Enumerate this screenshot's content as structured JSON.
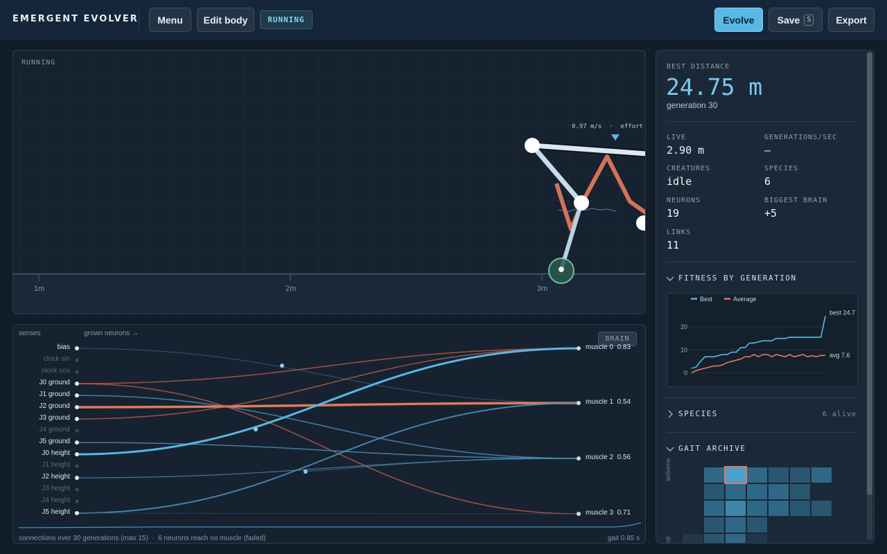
{
  "header": {
    "title": "EMERGENT EVOLVER",
    "menu_label": "Menu",
    "edit_label": "Edit body",
    "status": "RUNNING",
    "evolve_label": "Evolve",
    "save_label": "Save",
    "save_key": "S",
    "export_label": "Export"
  },
  "arena": {
    "label": "RUNNING",
    "ticks": [
      "1m",
      "2m",
      "3m"
    ],
    "readout": "0.97 m/s  ·  effort"
  },
  "brain": {
    "senses_label": "senses",
    "grown_label": "grown neurons →",
    "button_label": "BRAIN",
    "senses": [
      {
        "label": "bias",
        "active": true
      },
      {
        "label": "clock sin",
        "active": false
      },
      {
        "label": "clock cos",
        "active": false
      },
      {
        "label": "J0 ground",
        "active": true
      },
      {
        "label": "J1 ground",
        "active": true
      },
      {
        "label": "J2 ground",
        "active": true
      },
      {
        "label": "J3 ground",
        "active": true
      },
      {
        "label": "J4 ground",
        "active": false
      },
      {
        "label": "J5 ground",
        "active": true
      },
      {
        "label": "J0 height",
        "active": true
      },
      {
        "label": "J1 height",
        "active": false
      },
      {
        "label": "J2 height",
        "active": true
      },
      {
        "label": "J3 height",
        "active": false
      },
      {
        "label": "J4 height",
        "active": false
      },
      {
        "label": "J5 height",
        "active": true
      }
    ],
    "muscles": [
      {
        "label": "muscle 0",
        "value": "0.83"
      },
      {
        "label": "muscle 1",
        "value": "0.54"
      },
      {
        "label": "muscle 2",
        "value": "0.56"
      },
      {
        "label": "muscle 3",
        "value": "0.71"
      }
    ],
    "footer_left": "connections over 30 generations (max 15)  ·  6 neurons reach no muscle (faded)",
    "footer_right": "gait 0.85 s"
  },
  "stats": {
    "best_key": "BEST DISTANCE",
    "best_value": "24.75 m",
    "generation": "generation 30",
    "items": [
      {
        "key": "LIVE",
        "value": "2.90 m"
      },
      {
        "key": "GENERATIONS/SEC",
        "value": "—"
      },
      {
        "key": "CREATURES",
        "value": "idle"
      },
      {
        "key": "SPECIES",
        "value": "6"
      },
      {
        "key": "NEURONS",
        "value": "19"
      },
      {
        "key": "BIGGEST BRAIN",
        "value": "+5"
      },
      {
        "key": "LINKS",
        "value": "11"
      }
    ],
    "fitness_title": "FITNESS BY GENERATION",
    "species_title": "SPECIES",
    "species_count": "6 alive",
    "gait_title": "GAIT ARCHIVE",
    "gait_axis_top": "airborne",
    "gait_axis_bottom": "nd"
  },
  "chart_data": {
    "type": "line",
    "title": "",
    "x": [
      0,
      1,
      2,
      3,
      4,
      5,
      6,
      7,
      8,
      9,
      10,
      11,
      12,
      13,
      14,
      15,
      16,
      17,
      18,
      19,
      20,
      21,
      22,
      23,
      24,
      25,
      26,
      27,
      28,
      29,
      30
    ],
    "series": [
      {
        "name": "Best",
        "color": "#5ab8e6",
        "values": [
          2,
          2.5,
          5,
          7,
          7,
          7,
          7.5,
          8,
          8,
          9,
          9,
          11,
          11,
          13,
          13,
          13.5,
          14,
          14,
          14,
          15,
          15,
          15,
          15.5,
          15.5,
          15.5,
          15.5,
          15.5,
          15.5,
          15.5,
          15.5,
          24.75
        ]
      },
      {
        "name": "Average",
        "color": "#e07a5f",
        "values": [
          0,
          1,
          1.5,
          2,
          2.5,
          3,
          3,
          3.5,
          4.5,
          5,
          5.5,
          6,
          7,
          7,
          8,
          7,
          8,
          8,
          7,
          8,
          7.5,
          7,
          8,
          7,
          7.5,
          8,
          7,
          7.5,
          7,
          7.6,
          7.6
        ]
      }
    ],
    "yticks": [
      0,
      10,
      20
    ],
    "ylim": [
      -2,
      27
    ],
    "end_labels": [
      "best 24.7",
      "avg 7.6"
    ]
  }
}
